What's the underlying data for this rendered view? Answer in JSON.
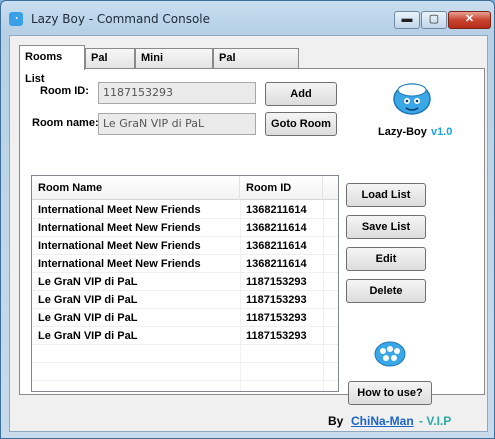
{
  "window": {
    "title": "Lazy Boy - Command Console",
    "min_label": "▬",
    "max_label": "▢",
    "close_label": "✕"
  },
  "tabs": [
    "Rooms List",
    "Pal List",
    "Mini Browser",
    "Pal Commands"
  ],
  "form": {
    "room_id_label": "Room ID:",
    "room_id_value": "1187153293",
    "room_name_label": "Room name:",
    "room_name_value": "Le GraN VIP di PaL",
    "add_label": "Add",
    "goto_label": "Goto Room"
  },
  "table": {
    "columns": [
      "Room Name",
      "Room ID"
    ],
    "rows": [
      [
        "International Meet New Friends",
        "1368211614"
      ],
      [
        "International Meet New Friends",
        "1368211614"
      ],
      [
        "International Meet New Friends",
        "1368211614"
      ],
      [
        "International Meet New Friends",
        "1368211614"
      ],
      [
        "Le GraN VIP di PaL",
        "1187153293"
      ],
      [
        "Le GraN VIP di PaL",
        "1187153293"
      ],
      [
        "Le GraN VIP di PaL",
        "1187153293"
      ],
      [
        "Le GraN VIP di PaL",
        "1187153293"
      ]
    ]
  },
  "side_buttons": {
    "load": "Load List",
    "save": "Save List",
    "edit": "Edit",
    "delete": "Delete",
    "howto": "How to use?"
  },
  "brand": {
    "name": "Lazy-Boy",
    "version": "v1.0",
    "accent": "#1aa3d9"
  },
  "credit": {
    "by": "By",
    "author": "ChiNa-Man",
    "suffix": "- V.I.P",
    "author_color": "#1a63c8",
    "suffix_color": "#2aa7a0"
  }
}
